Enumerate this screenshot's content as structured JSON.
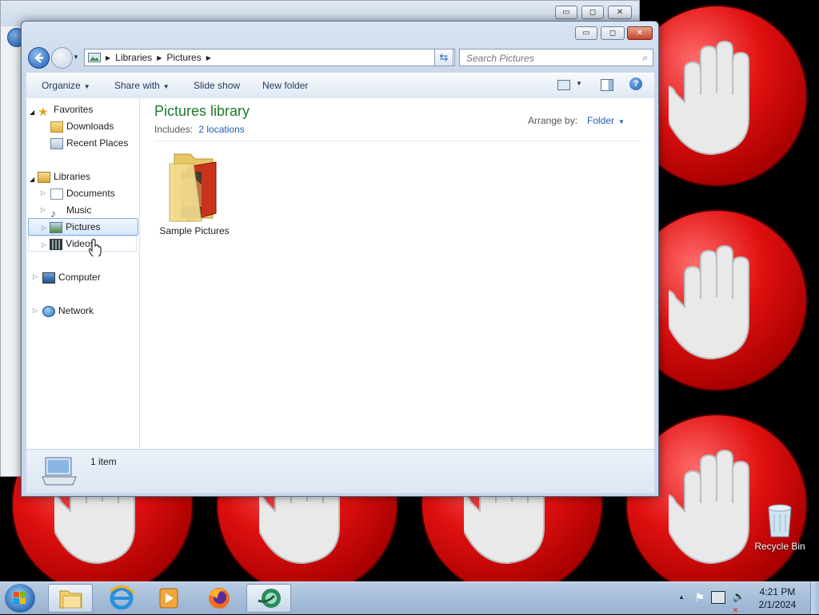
{
  "back_window": {
    "caption_buttons": [
      "▭",
      "◻",
      "✕"
    ]
  },
  "window": {
    "caption": {
      "minimize": "▭",
      "maximize": "◻",
      "close": "✕"
    },
    "address": {
      "crumbs": [
        "Libraries",
        "Pictures"
      ]
    },
    "search": {
      "placeholder": "Search Pictures"
    },
    "commands": {
      "organize": "Organize",
      "share_with": "Share with",
      "slide_show": "Slide show",
      "new_folder": "New folder"
    },
    "nav": {
      "favorites": "Favorites",
      "downloads": "Downloads",
      "recent_places": "Recent Places",
      "libraries": "Libraries",
      "documents": "Documents",
      "music": "Music",
      "pictures": "Pictures",
      "videos": "Videos",
      "computer": "Computer",
      "network": "Network"
    },
    "library": {
      "title": "Pictures library",
      "includes_label": "Includes:",
      "locations": "2 locations",
      "arrange_by": "Arrange by:",
      "arrange_value": "Folder"
    },
    "items": [
      {
        "label": "Sample Pictures"
      }
    ],
    "details": {
      "count": "1 item"
    }
  },
  "desktop": {
    "recycle_bin": "Recycle Bin"
  },
  "taskbar": {
    "time": "4:21 PM",
    "date": "2/1/2024"
  },
  "colors": {
    "accent": "#1e7a2e",
    "link": "#1e5fb5",
    "stop_red": "#e01010"
  }
}
